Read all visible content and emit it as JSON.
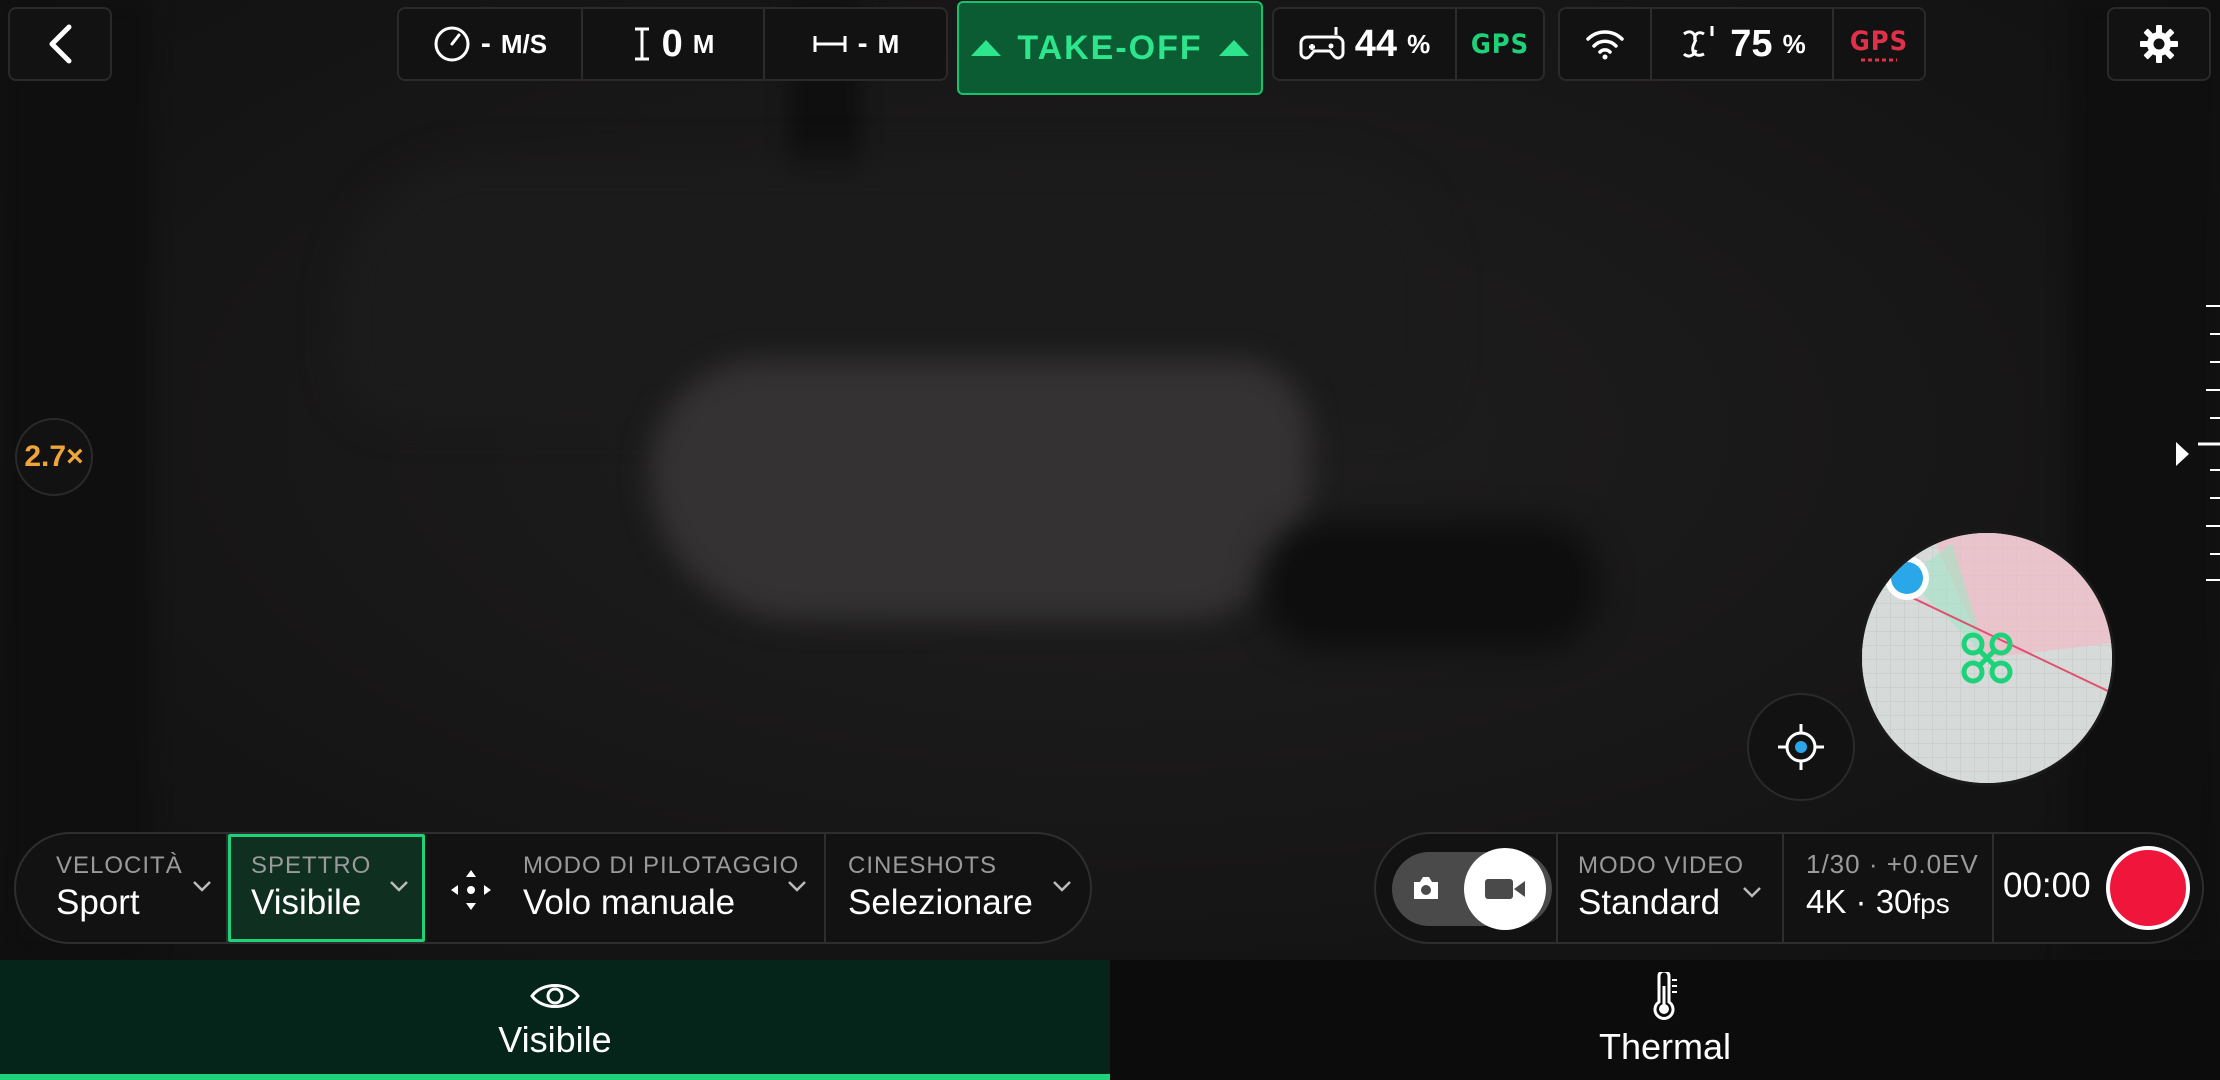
{
  "colors": {
    "accent": "#1ed27a",
    "takeoff_text": "#2de58c",
    "zoom": "#f0a53a",
    "gps_ok": "#1ed27a",
    "gps_bad": "#e0304a",
    "record": "#f0153b"
  },
  "topbar": {
    "speed": {
      "value": "-",
      "unit": "M/S",
      "icon": "speedometer-icon"
    },
    "altitude": {
      "value": "0",
      "unit": "M",
      "icon": "altitude-icon"
    },
    "distance": {
      "value": "-",
      "unit": "M",
      "icon": "distance-icon"
    },
    "takeoff_label": "TAKE-OFF",
    "controller": {
      "battery": "44",
      "unit": "%",
      "gps_label": "GPS",
      "icon": "remote-controller-icon"
    },
    "drone": {
      "battery": "75",
      "unit": "%",
      "gps_label": "GPS",
      "icons": [
        "wifi-icon",
        "drone-battery-icon"
      ]
    }
  },
  "zoom": "2.7×",
  "controls": {
    "velocita": {
      "label": "VELOCITÀ",
      "value": "Sport"
    },
    "spettro": {
      "label": "SPETTRO",
      "value": "Visibile"
    },
    "pilotaggio": {
      "label": "MODO DI PILOTAGGIO",
      "value": "Volo manuale"
    },
    "cineshots": {
      "label": "CINESHOTS",
      "value": "Selezionare"
    }
  },
  "camera": {
    "modo_video": {
      "label": "MODO VIDEO",
      "value": "Standard"
    },
    "exposure": "1/30 · +0.0EV",
    "resolution": "4K · 30",
    "fps_unit": "fps",
    "timer": "00:00"
  },
  "tabs": [
    {
      "label": "Visibile",
      "icon": "eye-icon",
      "active": true
    },
    {
      "label": "Thermal",
      "icon": "thermometer-icon",
      "active": false
    }
  ]
}
